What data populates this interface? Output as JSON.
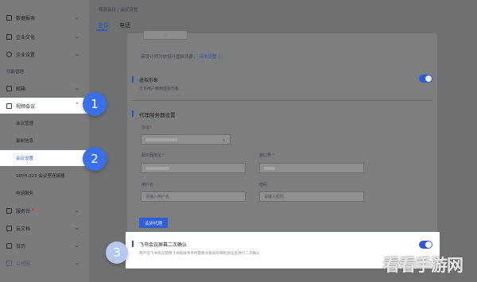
{
  "sidebar": {
    "items": [
      {
        "label": "数据报表"
      },
      {
        "label": "企业文化"
      },
      {
        "label": "企业设置"
      }
    ],
    "section_label": "功能管理",
    "items2": [
      {
        "label": "邮箱"
      },
      {
        "label": "视频会议"
      }
    ],
    "subitems": [
      {
        "label": "会议管理"
      },
      {
        "label": "录制信息"
      },
      {
        "label": "会议设置"
      },
      {
        "label": "SIP/H.323 会议室连接器"
      },
      {
        "label": "电话服务"
      }
    ],
    "items3": [
      {
        "label": "服务台"
      },
      {
        "label": "云文档"
      },
      {
        "label": "日历"
      },
      {
        "label": "公司圈"
      }
    ]
  },
  "breadcrumb": "视频会议 / 会议设置",
  "tabs": [
    {
      "label": "会议"
    },
    {
      "label": "电话"
    }
  ],
  "content": {
    "bg_hint": "该设计师为你设计虚拟背景。",
    "bg_link": "点击设置",
    "virtual_title": "虚拟形象",
    "virtual_desc": "允许用户使用虚拟形象",
    "proxy_title": "代理服务器设置",
    "protocol_label": "协议",
    "server_label": "服务器地址",
    "port_label": "端口号",
    "username_label": "用户名",
    "username_placeholder": "请输入用户名",
    "password_label": "密码",
    "password_placeholder": "请输入密码",
    "close_proxy_button": "关闭代理",
    "screen_share_title": "飞书会议屏幕二次确认",
    "screen_share_desc": "用户在飞书会议使用飞书投屏共享时需要对投屏的目标会议室进行二次确认"
  },
  "badges": [
    "1",
    "2",
    "3"
  ],
  "watermark": "看看手游网",
  "colors": {
    "accent": "#3370ff",
    "badge": "#3b6fe8"
  }
}
